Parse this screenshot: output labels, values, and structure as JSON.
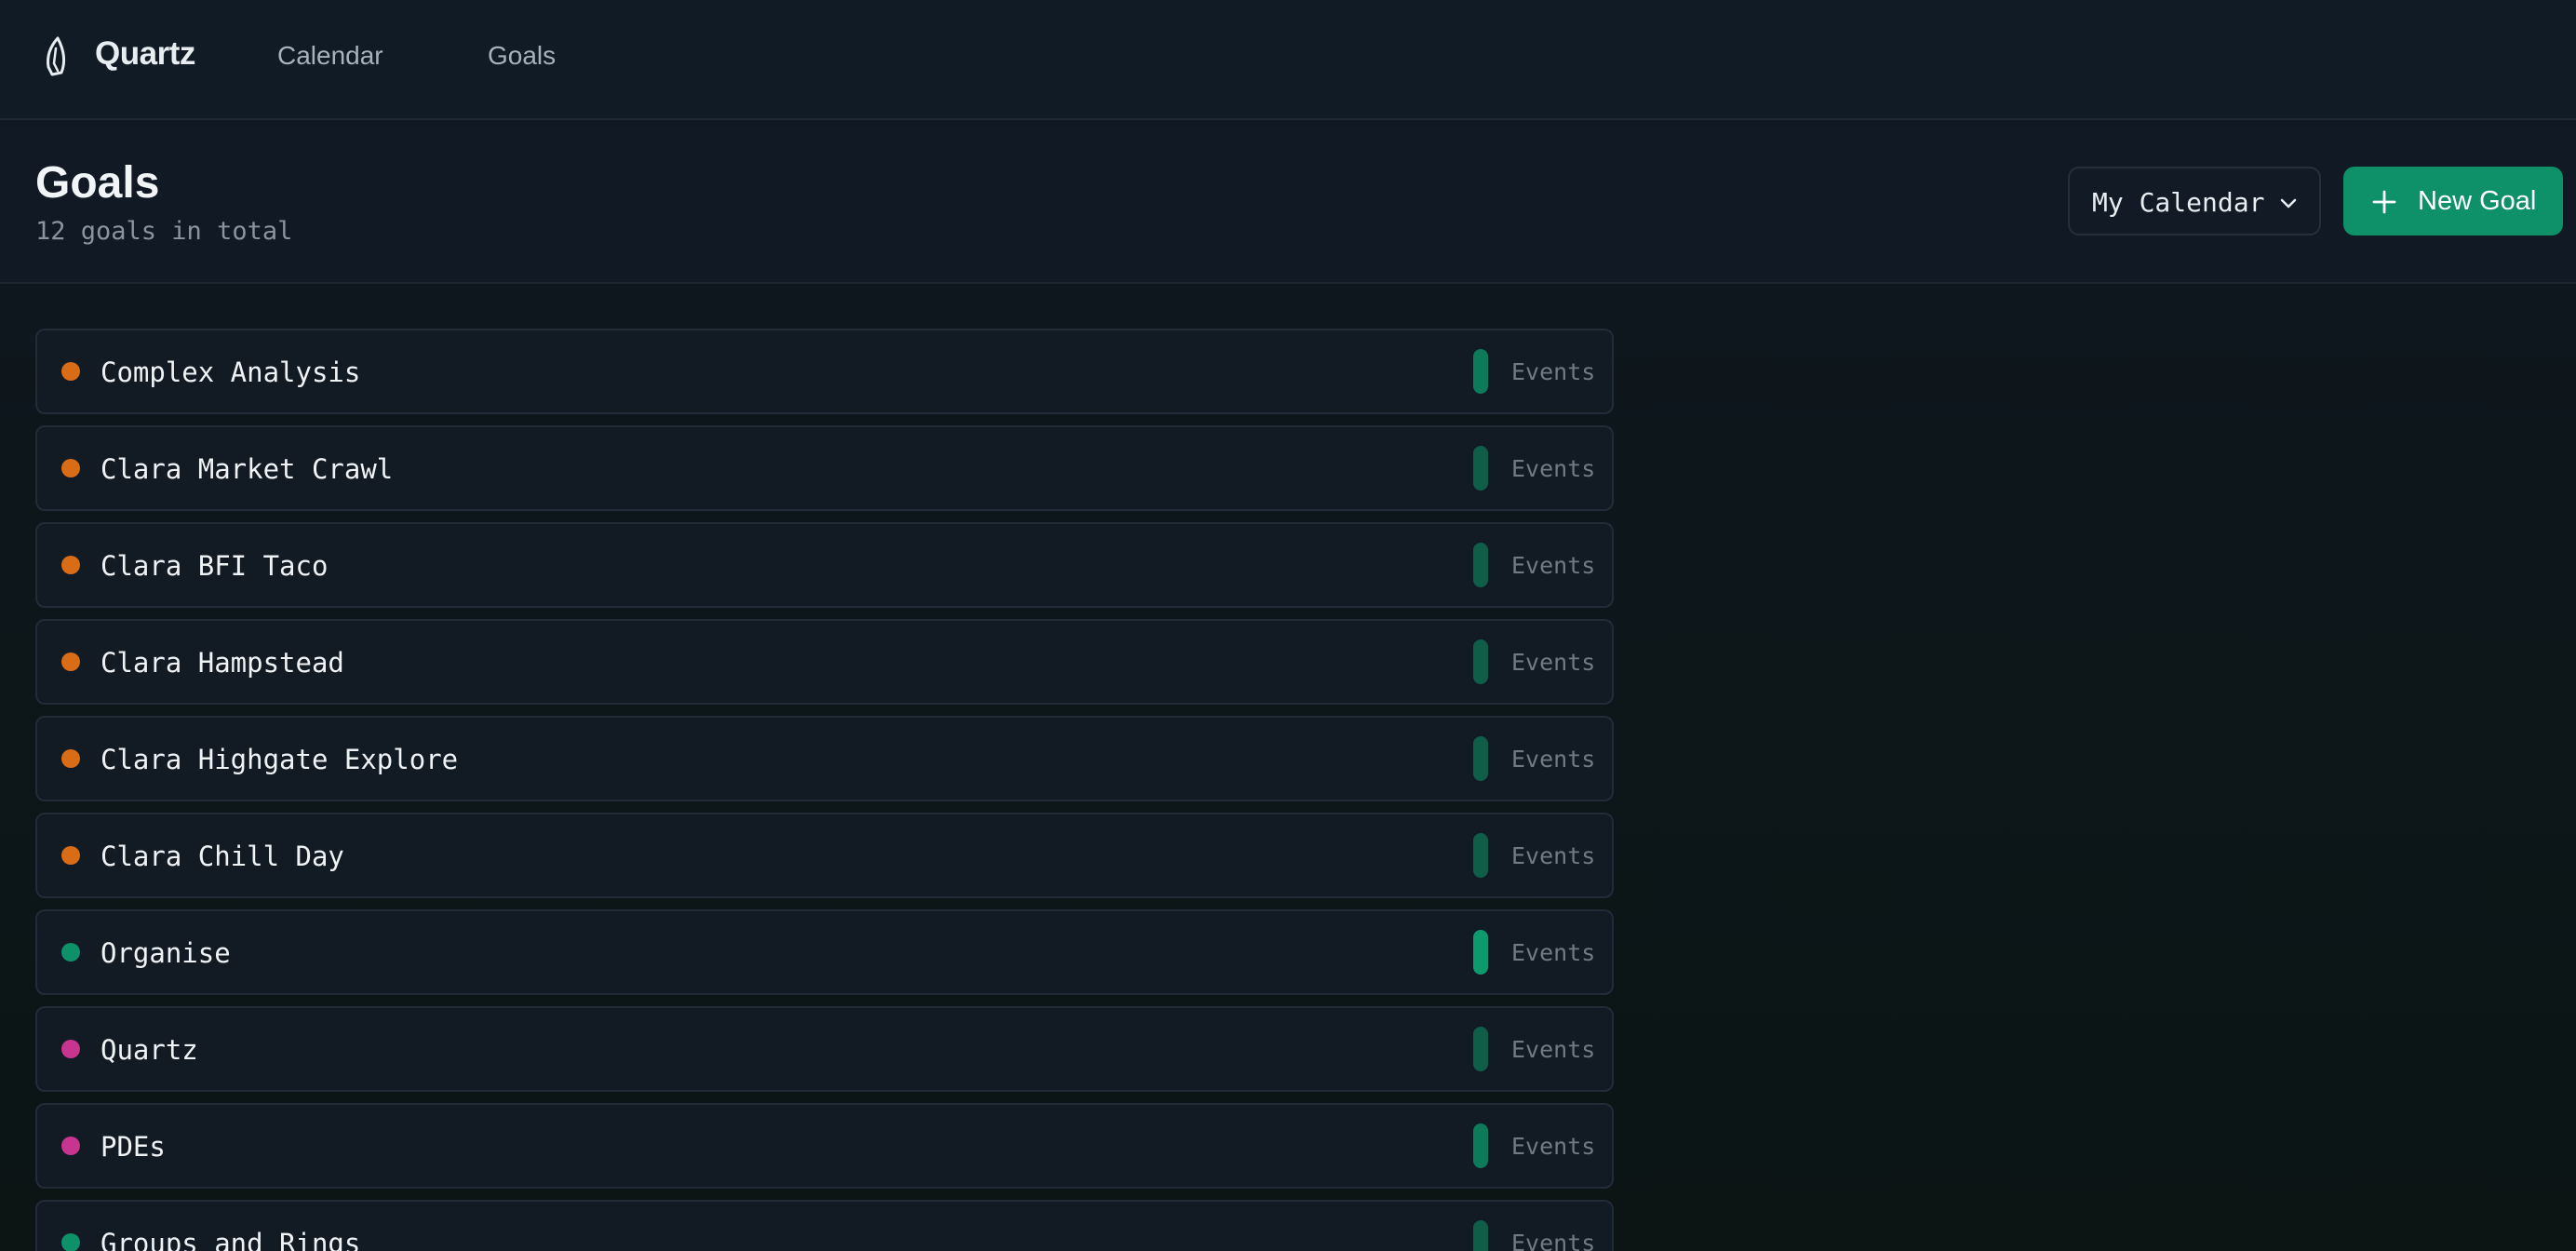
{
  "nav": {
    "brand": "Quartz",
    "links": [
      {
        "label": "Calendar"
      },
      {
        "label": "Goals"
      }
    ]
  },
  "header": {
    "title": "Goals",
    "subtitle": "12 goals in total",
    "calendar_select": {
      "value": "My Calendar"
    },
    "new_goal_label": "New Goal"
  },
  "colors": {
    "accent": "#0e9069",
    "orange": "#d96c17",
    "green": "#0e9069",
    "magenta": "#c7358f",
    "bar_active": "#0d9a6c",
    "bar_dim": "#0f5e48"
  },
  "goals": [
    {
      "name": "Complex Analysis",
      "dot": "#d96c17",
      "bar": "#0d7a5a",
      "events_label": "Events"
    },
    {
      "name": "Clara Market Crawl",
      "dot": "#d96c17",
      "bar": "#0f5e48",
      "events_label": "Events"
    },
    {
      "name": "Clara BFI Taco",
      "dot": "#d96c17",
      "bar": "#0f5e48",
      "events_label": "Events"
    },
    {
      "name": "Clara Hampstead",
      "dot": "#d96c17",
      "bar": "#0f5e48",
      "events_label": "Events"
    },
    {
      "name": "Clara Highgate Explore",
      "dot": "#d96c17",
      "bar": "#0f5e48",
      "events_label": "Events"
    },
    {
      "name": "Clara Chill Day",
      "dot": "#d96c17",
      "bar": "#0f5e48",
      "events_label": "Events"
    },
    {
      "name": "Organise",
      "dot": "#0e9069",
      "bar": "#0d9a6c",
      "events_label": "Events"
    },
    {
      "name": "Quartz",
      "dot": "#c7358f",
      "bar": "#0f5e48",
      "events_label": "Events"
    },
    {
      "name": "PDEs",
      "dot": "#c7358f",
      "bar": "#0d7a5a",
      "events_label": "Events"
    },
    {
      "name": "Groups and Rings",
      "dot": "#0e9069",
      "bar": "#0f5e48",
      "events_label": "Events"
    }
  ]
}
